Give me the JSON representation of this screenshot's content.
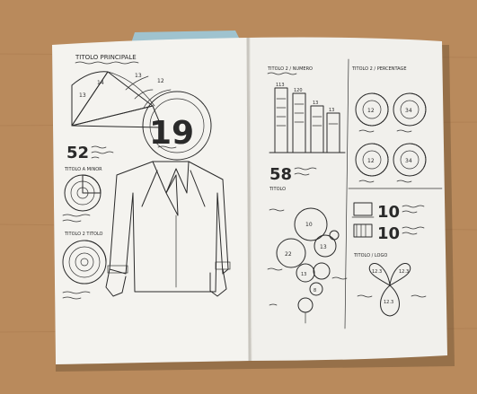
{
  "left_page": {
    "title": "TITOLO PRINCIPALE",
    "big_number": "19",
    "stat_number": "52",
    "label_minor": "TITOLO A MINOR",
    "label_second": "TITOLO 2 TITOLO",
    "arc_labels": [
      "13",
      "12",
      "13",
      "14"
    ]
  },
  "right_page": {
    "title_bars": "TITOLO 2 / NUMERO",
    "title_pies": "TITOLO 2 / PERCENTAGE",
    "big_number": "58",
    "subtitle": "TITOLO",
    "bar_labels": [
      "113",
      "120",
      "13",
      "13"
    ],
    "pie_values": [
      "12",
      "34",
      "12",
      "34"
    ],
    "bubble_values": [
      "10",
      "22",
      "13",
      "13",
      "8"
    ],
    "icon_numbers": [
      "10",
      "10"
    ],
    "petal_title": "TITOLO / LOGO",
    "petal_values": [
      "12.3",
      "12.3",
      "12.3"
    ]
  },
  "colors": {
    "wood": "#b98a5c",
    "paper": "#f4f3ef",
    "ink": "#2a2a2a",
    "tab": "#9fc3cf"
  }
}
